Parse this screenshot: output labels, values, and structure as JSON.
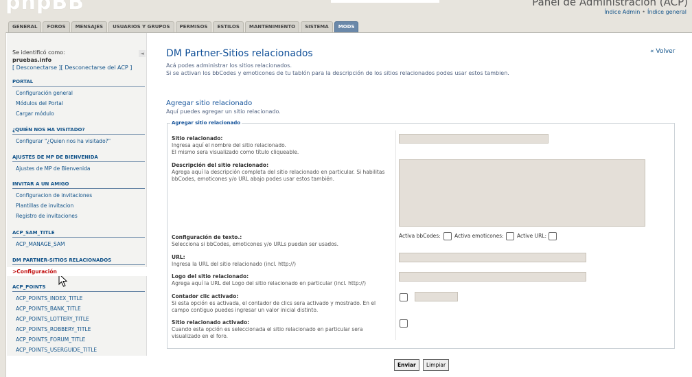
{
  "header": {
    "logo_text": "phpBB",
    "panel_title": "Panel de Administración (ACP)",
    "links": [
      "Índice Admin",
      "Índice general"
    ],
    "link_separator": "•"
  },
  "tabs": [
    {
      "label": "GENERAL",
      "active": false
    },
    {
      "label": "FOROS",
      "active": false
    },
    {
      "label": "MENSAJES",
      "active": false
    },
    {
      "label": "USUARIOS Y GRUPOS",
      "active": false
    },
    {
      "label": "PERMISOS",
      "active": false
    },
    {
      "label": "ESTILOS",
      "active": false
    },
    {
      "label": "MANTENIMIENTO",
      "active": false
    },
    {
      "label": "SISTEMA",
      "active": false
    },
    {
      "label": "MODS",
      "active": true
    }
  ],
  "sidebar": {
    "collapse_icon": "◄",
    "user": {
      "identified_as": "Se identificó como:",
      "username": "pruebas.info",
      "logout": "[ Desconectarse ][ Desconectarse del ACP ]"
    },
    "sections": [
      {
        "title": "PORTAL",
        "items": [
          "Configuración general",
          "Módulos del Portal",
          "Cargar módulo"
        ]
      },
      {
        "title": "¿QUIÉN NOS HA VISITADO?",
        "items": [
          "Configurar \"¿Quien nos ha visitado?\""
        ]
      },
      {
        "title": "AJUSTES DE MP DE BIENVENIDA",
        "items": [
          "Ajustes de MP de Bienvenida"
        ]
      },
      {
        "title": "INVITAR A UN AMIGO",
        "items": [
          "Configuracion de invitaciones",
          "Plantillas de invitacion",
          "Registro de invitaciones"
        ]
      },
      {
        "title": "ACP_SAM_TITLE",
        "items": [
          "ACP_MANAGE_SAM"
        ]
      },
      {
        "title": "DM PARTNER-SITIOS RELACIONADOS",
        "items": [
          "Configuración"
        ],
        "active_index": 0
      },
      {
        "title": "ACP_POINTS",
        "items": [
          "ACP_POINTS_INDEX_TITLE",
          "ACP_POINTS_BANK_TITLE",
          "ACP_POINTS_LOTTERY_TITLE",
          "ACP_POINTS_ROBBERY_TITLE",
          "ACP_POINTS_FORUM_TITLE",
          "ACP_POINTS_USERGUIDE_TITLE"
        ]
      }
    ]
  },
  "main": {
    "title": "DM Partner-Sitios relacionados",
    "back_link": "« Volver",
    "desc_line1": "Acá podes administrar los sitios relacionados.",
    "desc_line2": "Si se activan los bbCodes y emoticones de tu tablón para la descripción de los sitios relacionados podes usar estos tambien.",
    "section_title": "Agregar sitio relacionado",
    "section_desc": "Aquí puedes agregar un sitio relacionado.",
    "fieldset_legend": "Agregar sitio relacionado",
    "fields": {
      "site": {
        "label": "Sitio relacionado:",
        "hint1": "Ingresa aquí el nombre del sitio relacionado.",
        "hint2": "El mismo sera visualizado como título cliqueable.",
        "value": ""
      },
      "description": {
        "label": "Descripción del sitio relacionado:",
        "hint1": "Agrega aquí la descripción completa del sitio relacionado en particular. Si habilitas",
        "hint2": "bbCodes, emoticones y/o URL abajo podes usar estos también.",
        "value": ""
      },
      "text_config": {
        "label": "Configuración de texto.:",
        "hint1": "Selecciona si bbCodes, emoticones y/o URLs puedan ser usados.",
        "opt_bbcode": "Activa bbCodes:",
        "opt_smilies": "Activa emoticones:",
        "opt_url": "Active URL:"
      },
      "url": {
        "label": "URL:",
        "hint1": "Ingresa la URL del sitio relacionado (incl. http://)",
        "value": ""
      },
      "logo": {
        "label": "Logo del sitio relacionado:",
        "hint1": "Agrega aquí la URL del Logo del sitio relacionado en particular (incl. http://)",
        "value": ""
      },
      "counter": {
        "label": "Contador clic activado:",
        "hint1": "Si esta opción es activada, el contador de clics sera activado y mostrado. En el",
        "hint2": "campo contiguo puedes ingresar un valor inicial distinto.",
        "value": ""
      },
      "active": {
        "label": "Sitio relacionado activado:",
        "hint1": "Cuando esta opción es seleccionada el sitio relacionado en particular sera",
        "hint2": "visualizado en el foro."
      }
    },
    "buttons": {
      "submit": "Enviar",
      "reset": "Limpiar"
    }
  }
}
